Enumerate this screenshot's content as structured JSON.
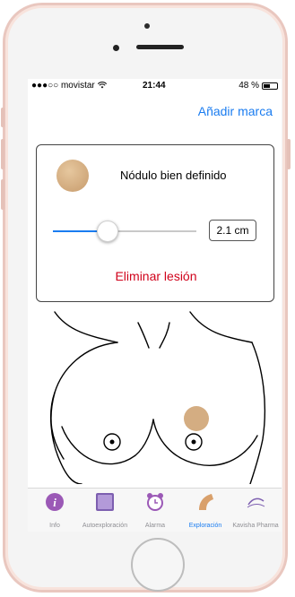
{
  "status_bar": {
    "carrier": "●●●○○ movistar",
    "time": "21:44",
    "battery_text": "48 %",
    "battery_level": 0.48
  },
  "header": {
    "action_label": "Añadir marca"
  },
  "card": {
    "nodule_label": "Nódulo bien definido",
    "size_value": "2.1 cm",
    "slider_value_fraction": 0.38,
    "delete_label": "Eliminar lesión",
    "swatch_color": "#d4ad82"
  },
  "tabs": [
    {
      "label": "Info",
      "icon": "info-icon"
    },
    {
      "label": "Autoexploración",
      "icon": "self-exam-icon"
    },
    {
      "label": "Alarma",
      "icon": "alarm-clock-icon"
    },
    {
      "label": "Exploración",
      "icon": "exploration-icon",
      "active": true
    },
    {
      "label": "Kavisha Pharma",
      "icon": "kavisha-logo-icon"
    }
  ],
  "colors": {
    "accent": "#1a7cf0",
    "danger": "#d0021b",
    "device_frame": "#e9c7bf"
  }
}
